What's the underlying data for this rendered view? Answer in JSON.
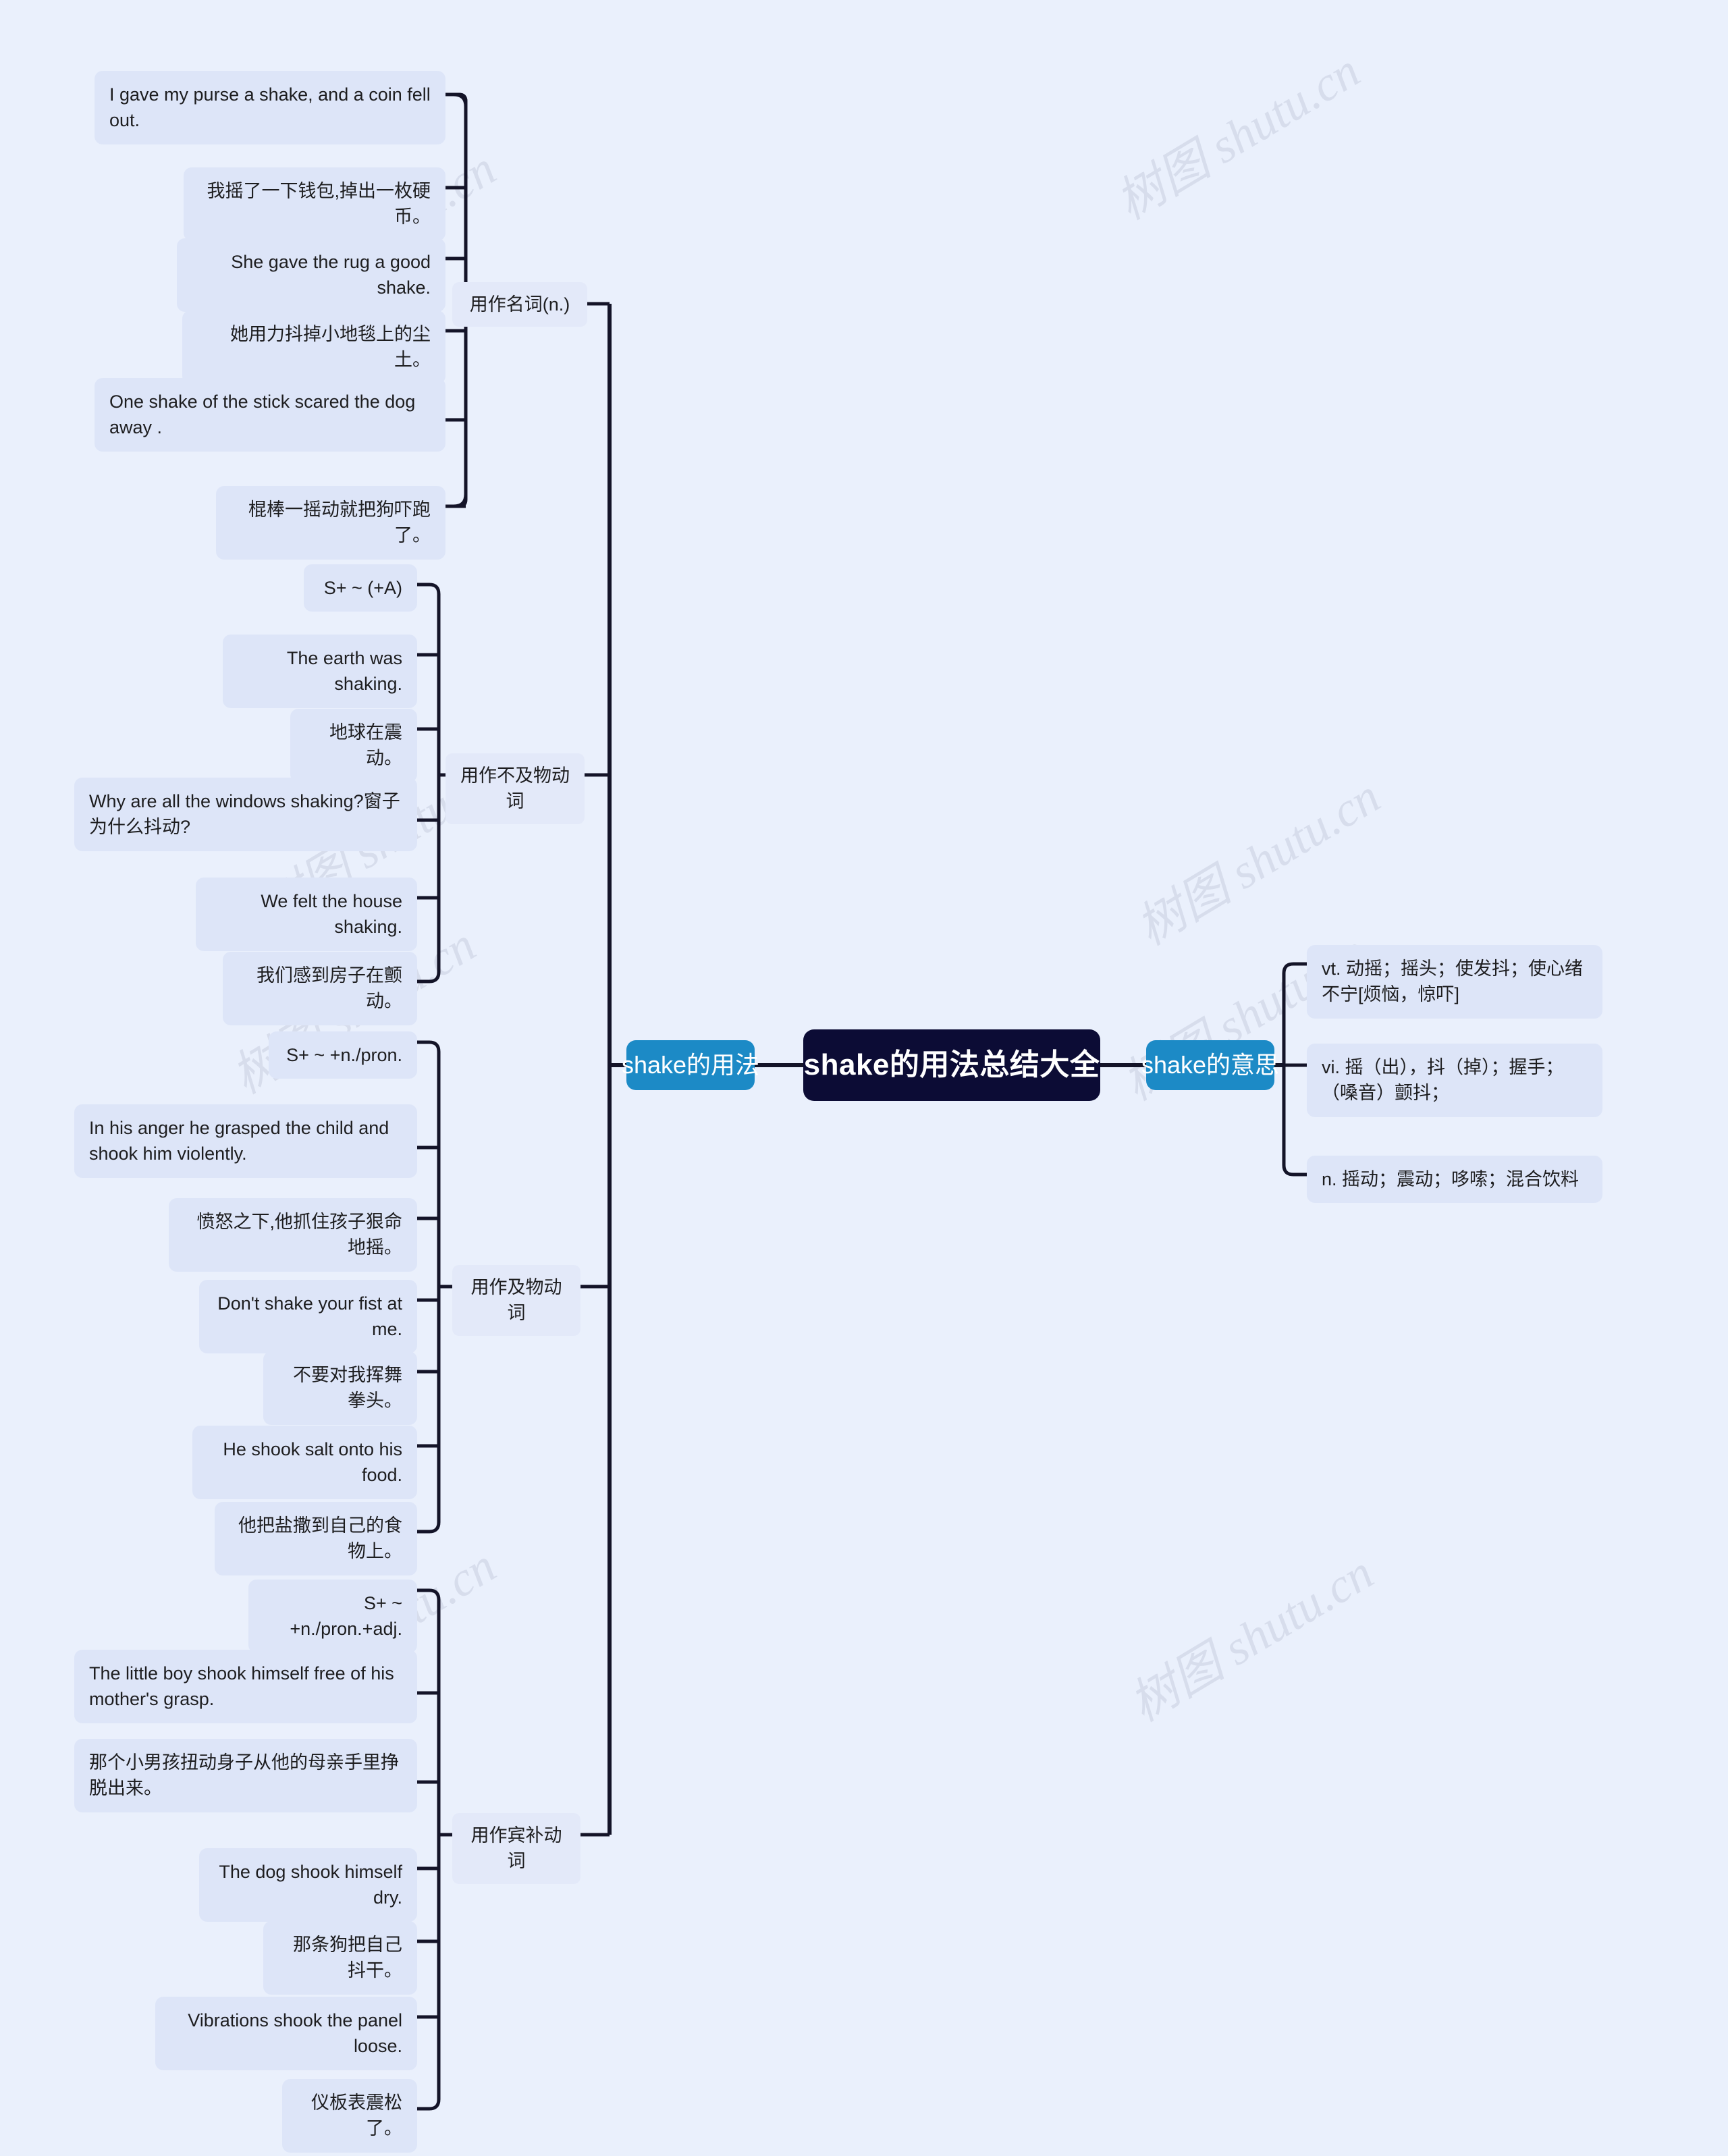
{
  "root": {
    "label": "shake的用法总结大全"
  },
  "branches": {
    "left": {
      "label": "shake的用法"
    },
    "right": {
      "label": "shake的意思"
    }
  },
  "meanings": [
    {
      "text": "vt. 动摇；摇头；使发抖；使心绪不宁[烦恼，惊吓]"
    },
    {
      "text": "vi. 摇（出），抖（掉）；握手；（嗓音）颤抖；"
    },
    {
      "text": "n. 摇动；震动；哆嗦；混合饮料"
    }
  ],
  "categories": [
    {
      "label": "用作名词(n.)",
      "items": [
        {
          "text": "I gave my purse a shake, and a coin fell out."
        },
        {
          "text": "我摇了一下钱包,掉出一枚硬币。"
        },
        {
          "text": "She gave the rug a good shake."
        },
        {
          "text": "她用力抖掉小地毯上的尘土。"
        },
        {
          "text": "One shake of the stick scared the dog away ."
        },
        {
          "text": "棍棒一摇动就把狗吓跑了。"
        }
      ]
    },
    {
      "label": "用作不及物动词",
      "items": [
        {
          "text": "S+ ~ (+A)"
        },
        {
          "text": "The earth was shaking."
        },
        {
          "text": "地球在震动。"
        },
        {
          "text": "Why are all the windows shaking?窗子为什么抖动?"
        },
        {
          "text": "We felt the house shaking."
        },
        {
          "text": "我们感到房子在颤动。"
        }
      ]
    },
    {
      "label": "用作及物动词",
      "items": [
        {
          "text": "S+ ~ +n./pron."
        },
        {
          "text": "In his anger he grasped the child and shook him violently."
        },
        {
          "text": "愤怒之下,他抓住孩子狠命地摇。"
        },
        {
          "text": "Don't shake your fist at me."
        },
        {
          "text": "不要对我挥舞拳头。"
        },
        {
          "text": "He shook salt onto his food."
        },
        {
          "text": "他把盐撒到自己的食物上。"
        }
      ]
    },
    {
      "label": "用作宾补动词",
      "items": [
        {
          "text": "S+ ~ +n./pron.+adj."
        },
        {
          "text": "The little boy shook himself free of his mother's grasp."
        },
        {
          "text": "那个小男孩扭动身子从他的母亲手里挣脱出来。"
        },
        {
          "text": "The dog shook himself dry."
        },
        {
          "text": "那条狗把自己抖干。"
        },
        {
          "text": "Vibrations shook the panel loose."
        },
        {
          "text": "仪板表震松了。"
        }
      ]
    }
  ],
  "watermarks": [
    {
      "text": "树图 shutu.cn"
    },
    {
      "text": "树图 shutu.cn"
    },
    {
      "text": "树图 shutu.cn"
    },
    {
      "text": "树图 shutu.cn"
    },
    {
      "text": "树图 shutu.cn"
    },
    {
      "text": "树图 shutu.cn"
    },
    {
      "text": "树图 shutu.cn"
    },
    {
      "text": "树图 shutu.cn"
    }
  ],
  "colors": {
    "background": "#eaf0fc",
    "root_fill": "#0c0c35",
    "branch_fill": "#1c8ac6",
    "leaf_fill": "#dde5f8",
    "link_stroke": "#141428",
    "watermark": "#c8cfe0"
  }
}
